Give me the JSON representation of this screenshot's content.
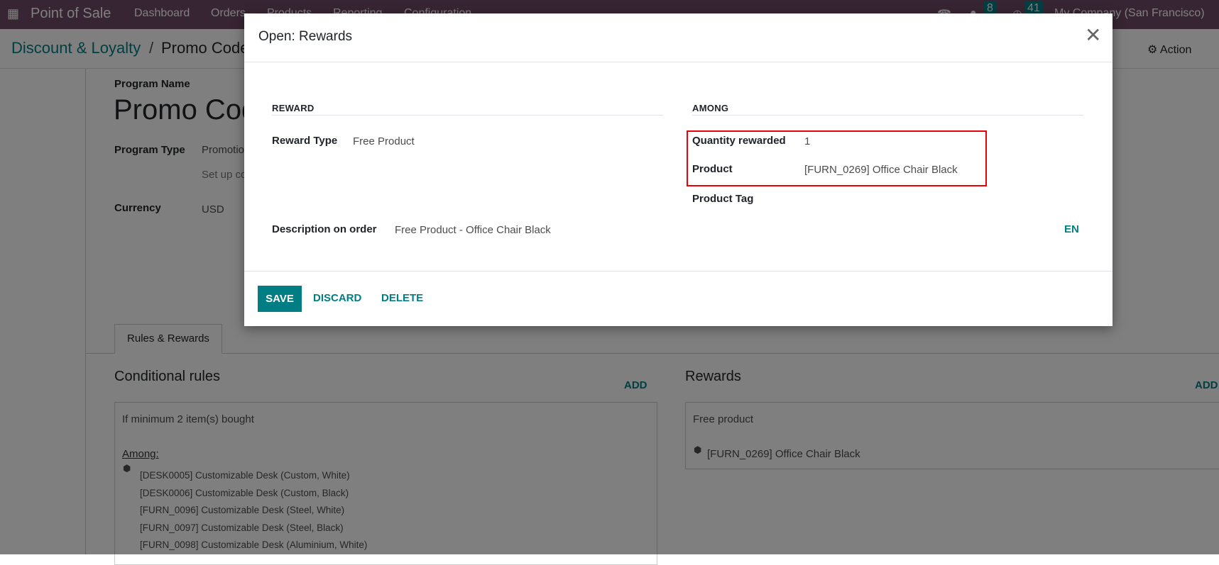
{
  "navbar": {
    "app": "Point of Sale",
    "menu": [
      "Dashboard",
      "Orders",
      "Products",
      "Reporting",
      "Configuration"
    ],
    "messages_count": "8",
    "activities_count": "41",
    "company": "My Company (San Francisco)"
  },
  "breadcrumb": {
    "parent": "Discount & Loyalty",
    "current": "Promo Code"
  },
  "action_label": "Action",
  "form": {
    "program_name_label": "Program Name",
    "program_name": "Promo Code",
    "program_type_label": "Program Type",
    "program_type": "Promotion",
    "program_type_help": "Set up conditional rules",
    "currency_label": "Currency",
    "currency": "USD"
  },
  "tabs": [
    {
      "label": "Rules & Rewards",
      "active": true
    }
  ],
  "rules": {
    "title": "Conditional rules",
    "add": "ADD",
    "condition": "If minimum 2 item(s) bought",
    "among_label": "Among:",
    "products": [
      "[DESK0005] Customizable Desk (Custom, White)",
      "[DESK0006] Customizable Desk (Custom, Black)",
      "[FURN_0096] Customizable Desk (Steel, White)",
      "[FURN_0097] Customizable Desk (Steel, Black)",
      "[FURN_0098] Customizable Desk (Aluminium, White)"
    ]
  },
  "rewards": {
    "title": "Rewards",
    "add": "ADD",
    "type": "Free product",
    "product": "[FURN_0269] Office Chair Black"
  },
  "modal": {
    "title": "Open: Rewards",
    "reward_section": "REWARD",
    "among_section": "AMONG",
    "reward_type_label": "Reward Type",
    "reward_type": "Free Product",
    "quantity_label": "Quantity rewarded",
    "quantity": "1",
    "product_label": "Product",
    "product": "[FURN_0269] Office Chair Black",
    "product_tag_label": "Product Tag",
    "product_tag": "",
    "description_label": "Description on order",
    "description": "Free Product - Office Chair Black",
    "lang": "EN",
    "save": "SAVE",
    "discard": "DISCARD",
    "delete": "DELETE"
  },
  "colors": {
    "brand": "#714b67",
    "accent": "#017e84",
    "highlight": "#e8000b"
  }
}
